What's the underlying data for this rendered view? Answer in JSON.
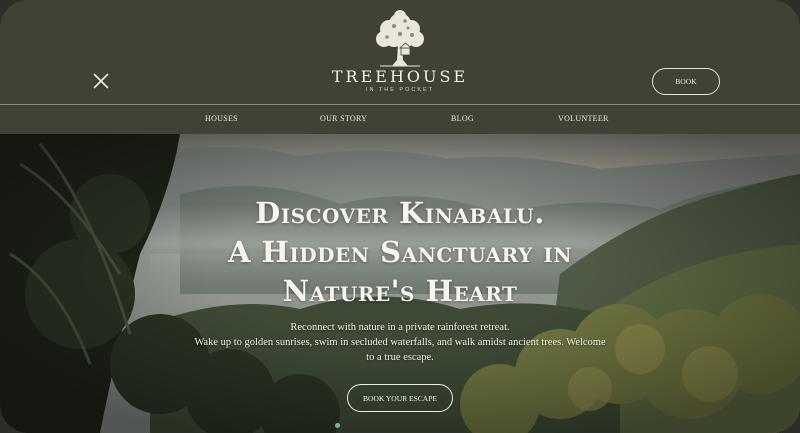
{
  "brand": {
    "name": "TREEHOUSE",
    "tagline": "IN THE POCKET",
    "logo_icon": "tree-icon"
  },
  "header": {
    "menu_icon": "close-icon",
    "book_label": "BOOK"
  },
  "nav": {
    "items": [
      {
        "label": "HOUSES"
      },
      {
        "label": "OUR STORY"
      },
      {
        "label": "BLOG"
      },
      {
        "label": "VOLUNTEER"
      }
    ]
  },
  "hero": {
    "title_lines": [
      "Discover Kinabalu.",
      "A Hidden Sanctuary in",
      "Nature's Heart"
    ],
    "description_lines": [
      "Reconnect with nature in a private rainforest retreat.",
      "Wake up to golden sunrises, swim in secluded waterfalls, and walk amidst ancient trees. Welcome",
      "to a true escape."
    ],
    "cta_label": "BOOK YOUR ESCAPE"
  },
  "colors": {
    "header_bg": "#3f4235",
    "text_light": "#f1efe6",
    "accent_dot": "#6fb8a8"
  }
}
